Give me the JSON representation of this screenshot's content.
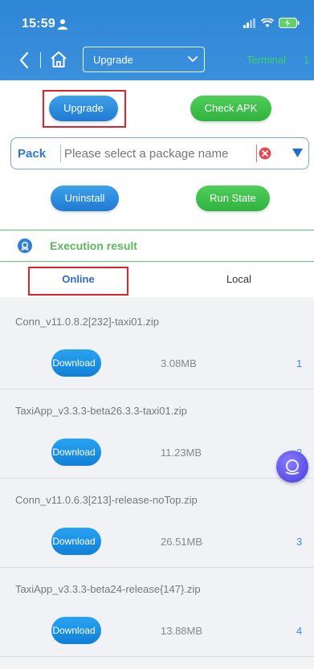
{
  "status_bar": {
    "time": "15:59"
  },
  "nav": {
    "select_value": "Upgrade",
    "terminal_label": "Terminal",
    "terminal_count": "1"
  },
  "actions": {
    "upgrade": "Upgrade",
    "check_apk": "Check APK",
    "uninstall": "Uninstall",
    "run_state": "Run State"
  },
  "pack": {
    "label": "Pack",
    "placeholder": "Please select a package name"
  },
  "execution": {
    "label": "Execution result"
  },
  "tabs": {
    "online": "Online",
    "local": "Local"
  },
  "files": [
    {
      "name": "Conn_v11.0.8.2[232]-taxi01.zip",
      "size": "3.08MB",
      "index": "1",
      "download": "Download"
    },
    {
      "name": "TaxiApp_v3.3.3-beta26.3.3-taxi01.zip",
      "size": "11.23MB",
      "index": "2",
      "download": "Download"
    },
    {
      "name": "Conn_v11.0.6.3[213]-release-noTop.zip",
      "size": "26.51MB",
      "index": "3",
      "download": "Download"
    },
    {
      "name": "TaxiApp_v3.3.3-beta24-release{147}.zip",
      "size": "13.88MB",
      "index": "4",
      "download": "Download"
    }
  ],
  "colors": {
    "header": "#2f86d6",
    "accent_green": "#5cb85c",
    "highlight_red": "#e0222a",
    "primary_blue": "#1f7bd2"
  }
}
